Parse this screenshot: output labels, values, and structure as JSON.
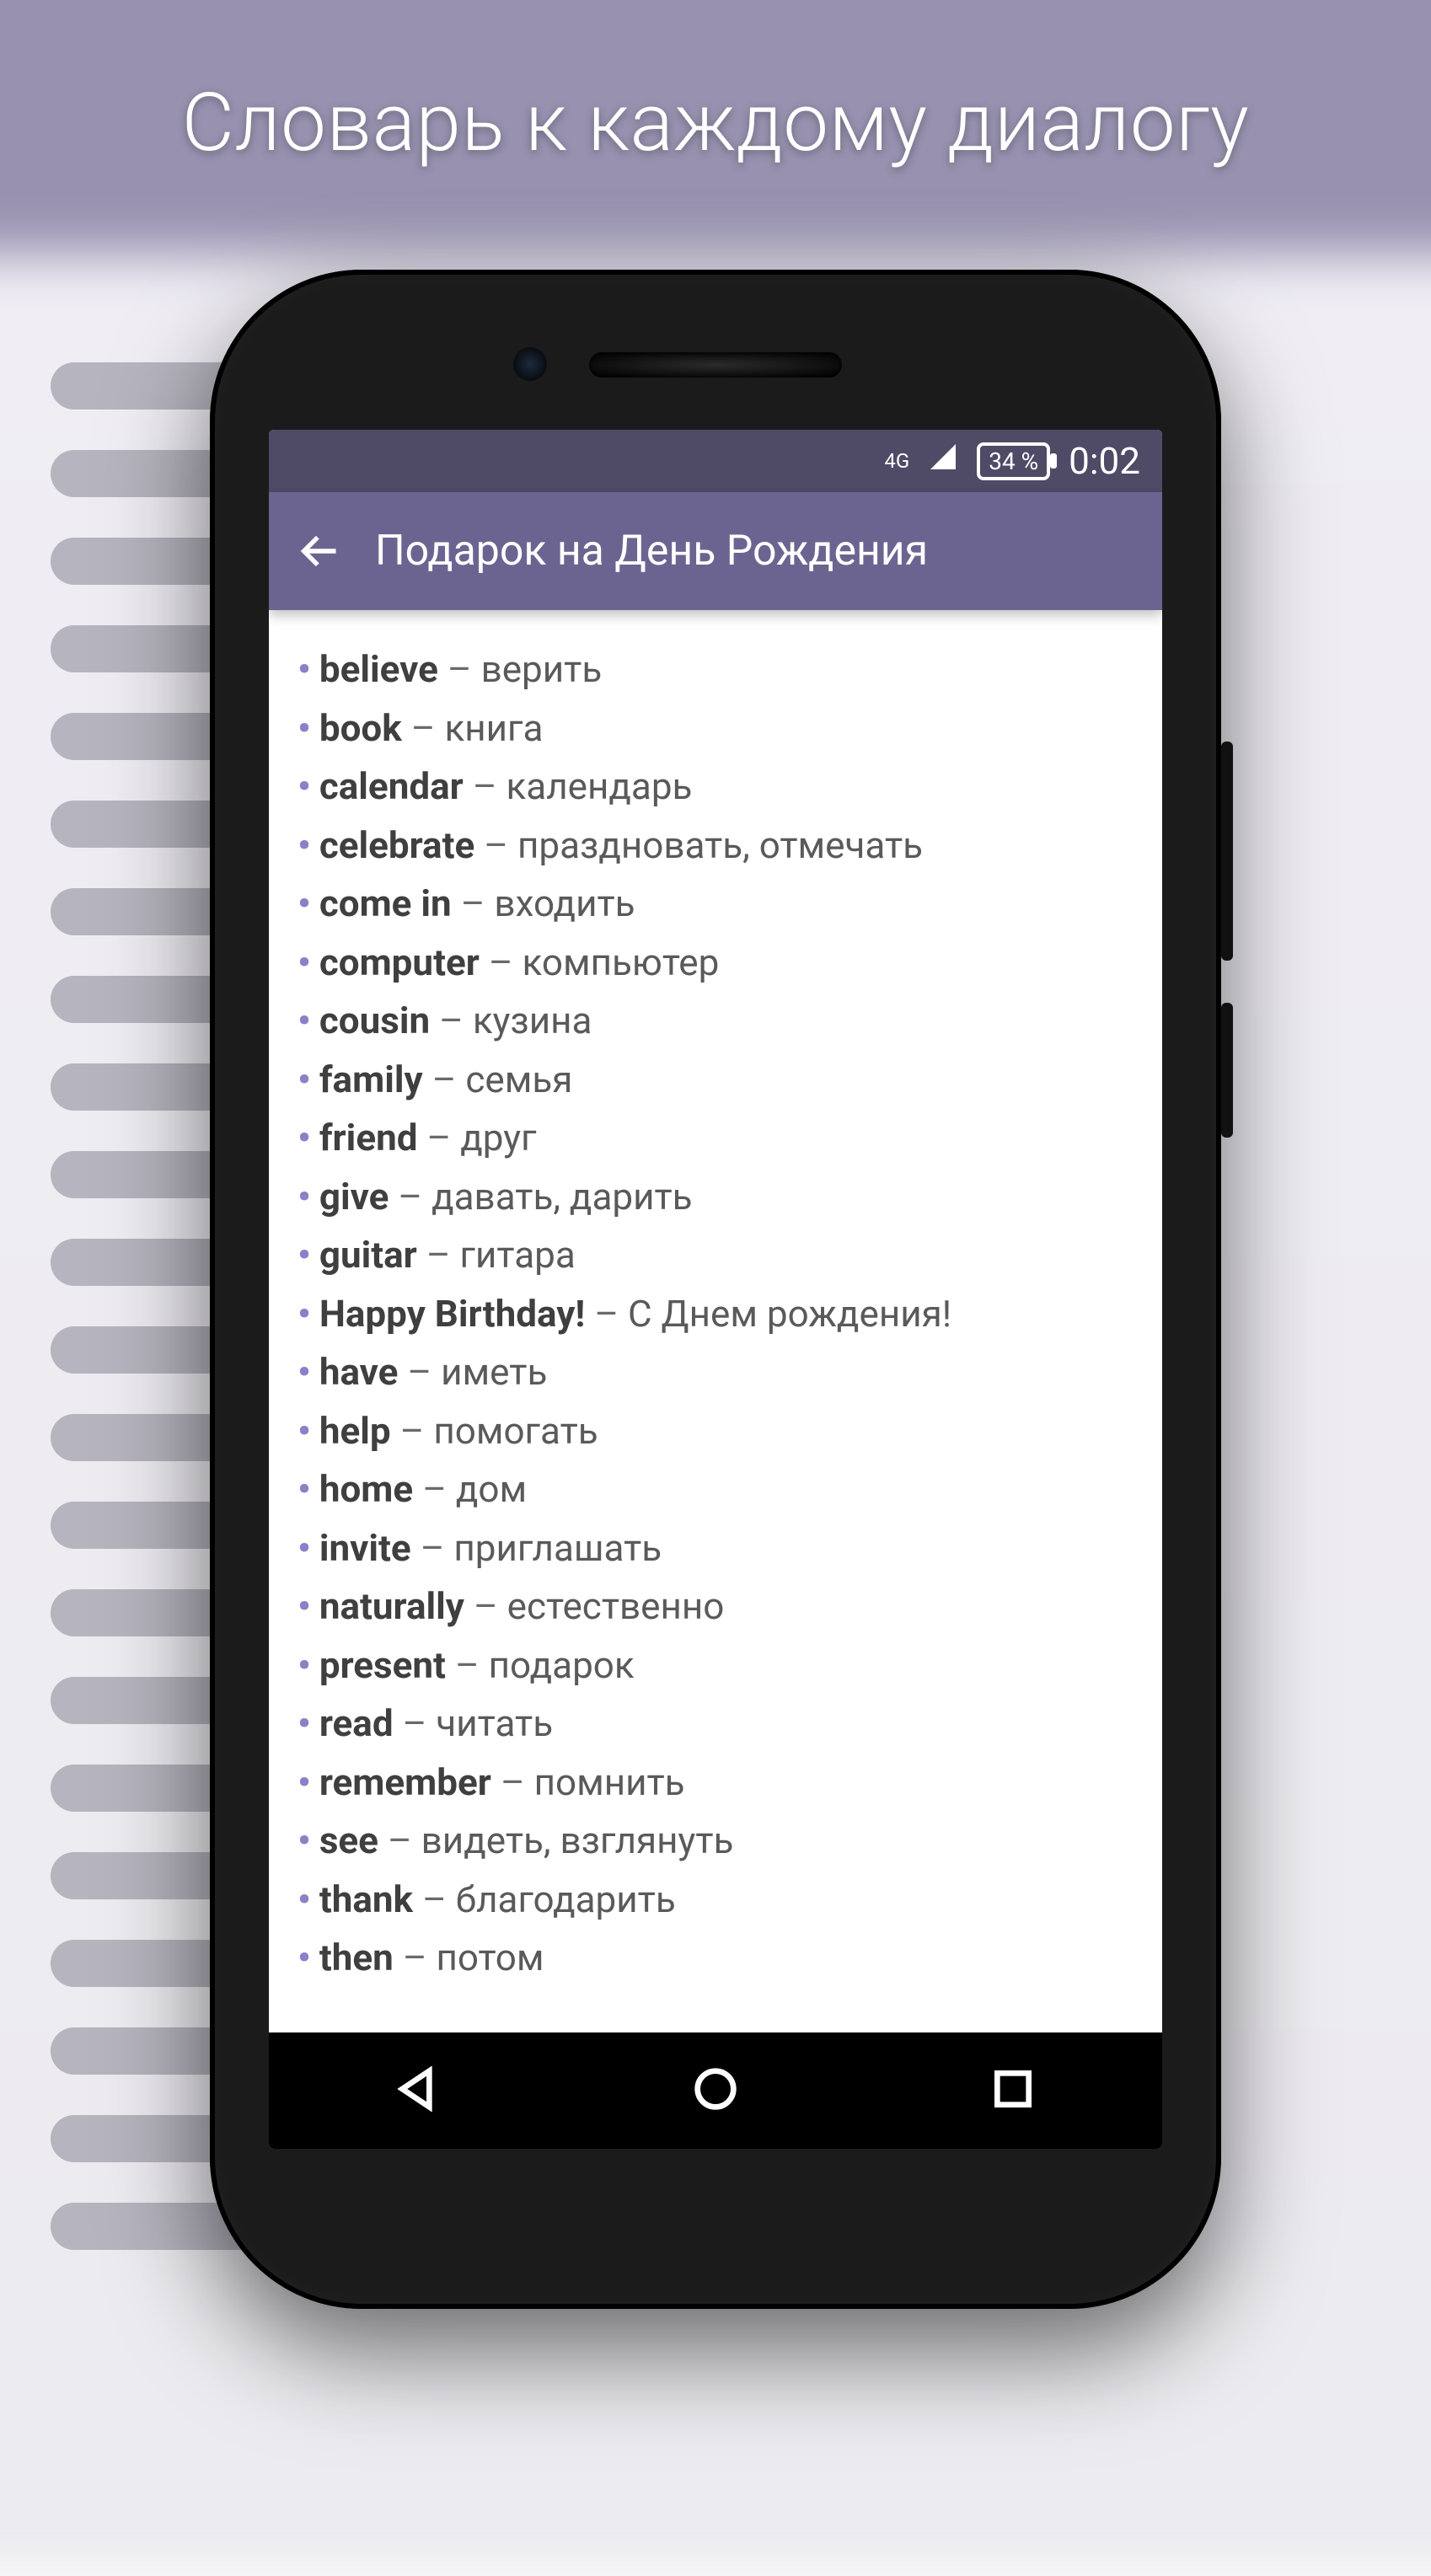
{
  "headline": "Словарь к каждому диалогу",
  "status": {
    "network": "4G",
    "battery": "34 %",
    "time": "0:02"
  },
  "appbar": {
    "title": "Подарок на День Рождения"
  },
  "colors": {
    "statusbar": "#4f4a66",
    "appbar": "#6c6490",
    "bullet": "#8b80c9"
  },
  "vocab": [
    {
      "word": "believe",
      "translation": "верить"
    },
    {
      "word": "book",
      "translation": "книга"
    },
    {
      "word": "calendar",
      "translation": "календарь"
    },
    {
      "word": "celebrate",
      "translation": "праздновать, отмечать"
    },
    {
      "word": "come in",
      "translation": "входить"
    },
    {
      "word": "computer",
      "translation": "компьютер"
    },
    {
      "word": "cousin",
      "translation": "кузина"
    },
    {
      "word": "family",
      "translation": "семья"
    },
    {
      "word": "friend",
      "translation": "друг"
    },
    {
      "word": "give",
      "translation": "давать, дарить"
    },
    {
      "word": "guitar",
      "translation": "гитара"
    },
    {
      "word": "Happy Birthday!",
      "translation": "С Днем рождения!"
    },
    {
      "word": "have",
      "translation": "иметь"
    },
    {
      "word": "help",
      "translation": "помогать"
    },
    {
      "word": "home",
      "translation": "дом"
    },
    {
      "word": "invite",
      "translation": "приглашать"
    },
    {
      "word": "naturally",
      "translation": "естественно"
    },
    {
      "word": "present",
      "translation": "подарок"
    },
    {
      "word": "read",
      "translation": "читать"
    },
    {
      "word": "remember",
      "translation": "помнить"
    },
    {
      "word": "see",
      "translation": "видеть, взглянуть"
    },
    {
      "word": "thank",
      "translation": "благодарить"
    },
    {
      "word": "then",
      "translation": "потом"
    }
  ]
}
